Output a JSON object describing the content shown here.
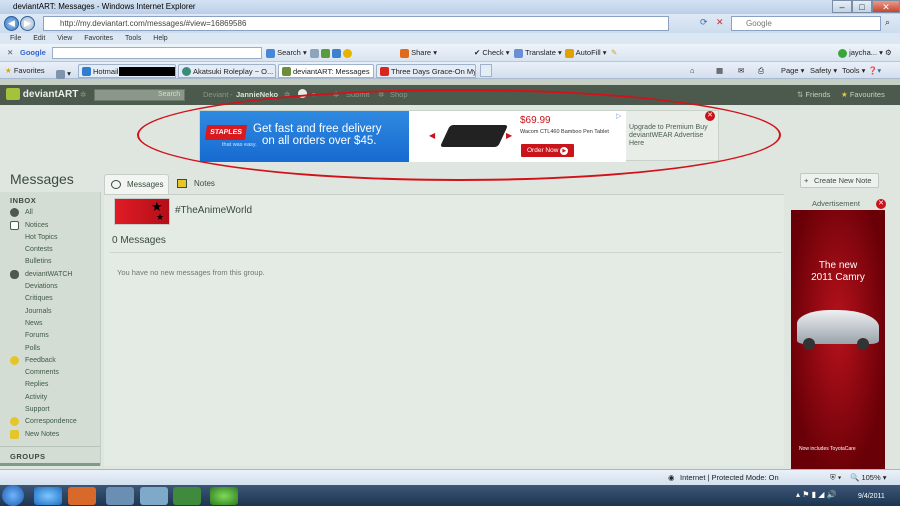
{
  "window": {
    "title": "deviantART: Messages - Windows Internet Explorer"
  },
  "browser": {
    "address": "http://my.deviantart.com/messages/#view=16869586",
    "search_placeholder": "Google",
    "menu": [
      "File",
      "Edit",
      "View",
      "Favorites",
      "Tools",
      "Help"
    ],
    "google_toolbar": {
      "brand": "Google",
      "items": [
        "Search",
        "Share",
        "Check",
        "Translate",
        "AutoFill"
      ],
      "user": "jaycha..."
    },
    "favorites_label": "Favorites",
    "tabs": [
      "Hotmail -",
      "Akatsuki Roleplay ~ O...",
      "deviantART: Messages",
      "Three Days Grace-On My ..."
    ],
    "command_bar": [
      "Page",
      "Safety",
      "Tools"
    ],
    "status": {
      "zone": "Internet | Protected Mode: On",
      "zoom": "105%"
    }
  },
  "site": {
    "logo": "deviantART",
    "search_button": "Search",
    "nav": {
      "deviant_prefix": "Deviant",
      "user": "JannieNeko",
      "submit": "Submit",
      "shop": "Shop",
      "friends": "Friends",
      "favourites": "Favourites"
    }
  },
  "ad_banner": {
    "brand": "STAPLES",
    "tagline": "that was easy.",
    "headline_line1": "Get fast and free delivery",
    "headline_line2": "on all orders over $45.",
    "price": "$69.99",
    "product": "Wacom CTL460 Bamboo Pen Tablet",
    "order_button": "Order Now",
    "premium_text": "Upgrade to Premium Buy deviantWEAR Advertise Here"
  },
  "messages": {
    "title": "Messages",
    "tabs": [
      {
        "label": "Messages"
      },
      {
        "label": "Notes"
      }
    ],
    "create_note": "Create New Note",
    "group_name": "#TheAnimeWorld",
    "count_label": "0 Messages",
    "empty_text": "You have no new messages from this group."
  },
  "sidebar": {
    "inbox_header": "INBOX",
    "groups_header": "GROUPS",
    "items": [
      {
        "label": "All",
        "top": true
      },
      {
        "label": "Notices",
        "top": true
      },
      {
        "label": "Hot Topics"
      },
      {
        "label": "Contests"
      },
      {
        "label": "Bulletins"
      },
      {
        "label": "deviantWATCH",
        "top": true
      },
      {
        "label": "Deviations"
      },
      {
        "label": "Critiques"
      },
      {
        "label": "Journals"
      },
      {
        "label": "News"
      },
      {
        "label": "Forums"
      },
      {
        "label": "Polls"
      },
      {
        "label": "Feedback",
        "top": true
      },
      {
        "label": "Comments"
      },
      {
        "label": "Replies"
      },
      {
        "label": "Activity"
      },
      {
        "label": "Support"
      },
      {
        "label": "Correspondence",
        "top": true
      },
      {
        "label": "New Notes",
        "top": true
      }
    ]
  },
  "side_ad": {
    "label": "Advertisement",
    "headline_line1": "The new",
    "headline_line2": "2011 Camry",
    "footer": "Now includes ToyotaCare"
  },
  "taskbar": {
    "time": "9/4/2011"
  }
}
